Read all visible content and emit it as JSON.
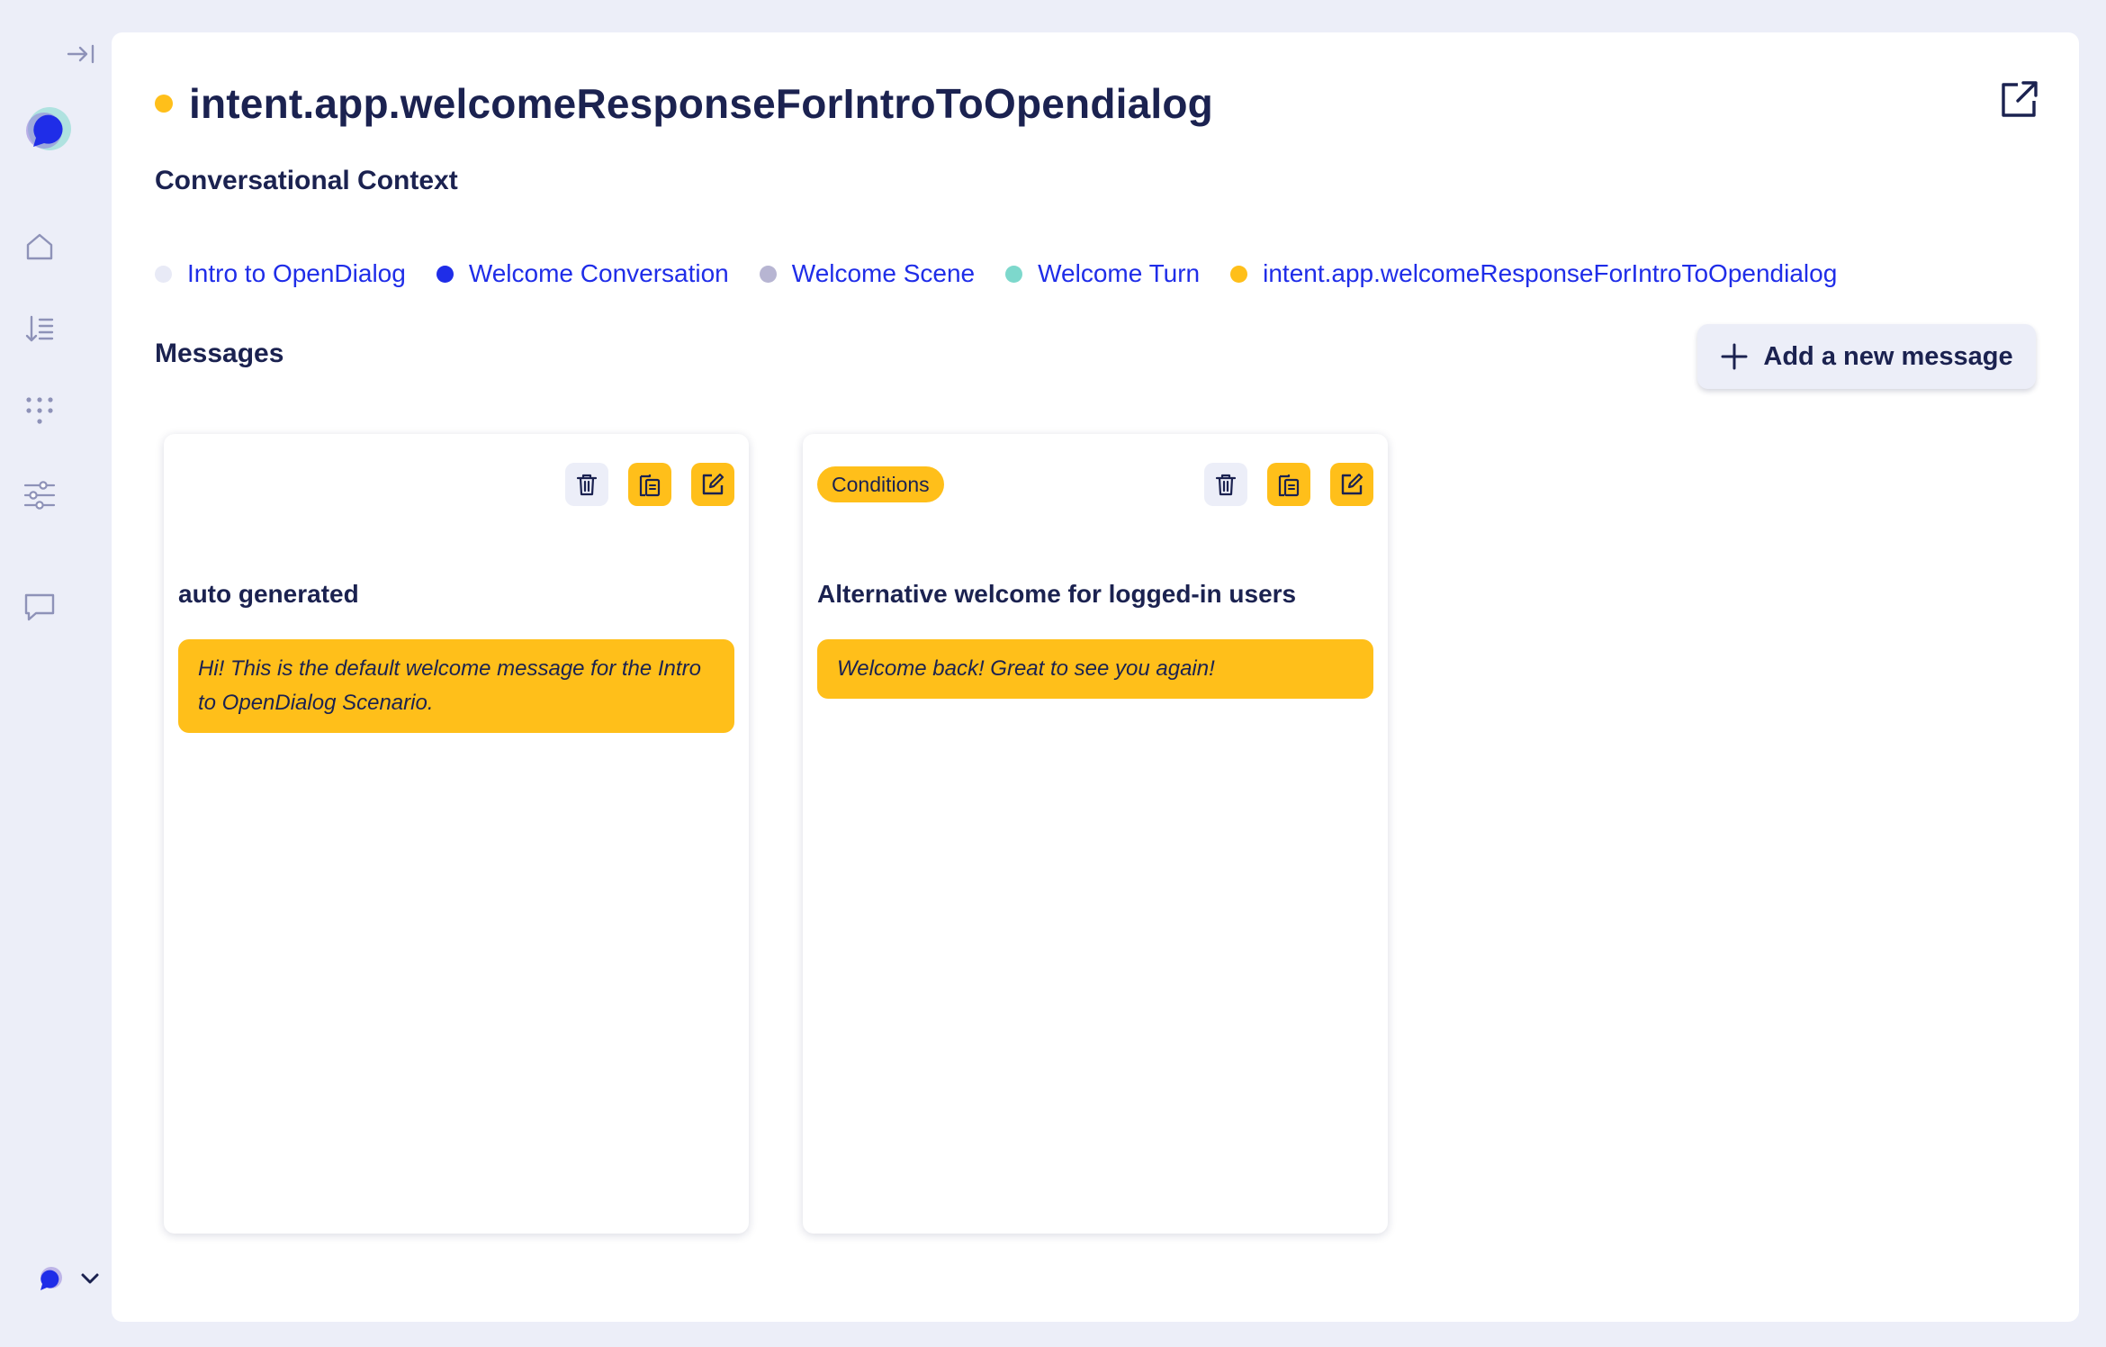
{
  "sidebar": {
    "items": [
      {
        "icon": "collapse-sidebar-icon"
      },
      {
        "icon": "opendialog-logo"
      },
      {
        "icon": "home-icon"
      },
      {
        "icon": "sort-list-icon"
      },
      {
        "icon": "grid-dots-icon"
      },
      {
        "icon": "sliders-icon"
      },
      {
        "icon": "chat-icon"
      },
      {
        "icon": "workspace-logo"
      },
      {
        "icon": "chevron-down-icon"
      }
    ]
  },
  "header": {
    "title": "intent.app.welcomeResponseForIntroToOpendialog",
    "status_color": "#ffbf1a",
    "external_link_icon": "external-link-icon"
  },
  "context": {
    "label": "Conversational Context",
    "crumbs": [
      {
        "label": "Intro to OpenDialog",
        "color": "#e8eaf6"
      },
      {
        "label": "Welcome Conversation",
        "color": "#1f2de8"
      },
      {
        "label": "Welcome Scene",
        "color": "#b7b5d2"
      },
      {
        "label": "Welcome Turn",
        "color": "#7dd8cc"
      },
      {
        "label": "intent.app.welcomeResponseForIntroToOpendialog",
        "color": "#ffbf1a"
      }
    ]
  },
  "messages": {
    "label": "Messages",
    "add_button_label": "Add a new message",
    "cards": [
      {
        "has_conditions": false,
        "name": "auto generated",
        "text": "Hi! This is the default welcome message for the Intro to OpenDialog Scenario."
      },
      {
        "has_conditions": true,
        "conditions_label": "Conditions",
        "name": "Alternative welcome for logged-in users",
        "text": "Welcome back! Great to see you again!"
      }
    ]
  },
  "colors": {
    "accent": "#ffbf1a",
    "link": "#1f2de8",
    "text": "#1b2250",
    "background": "#eceef8"
  }
}
